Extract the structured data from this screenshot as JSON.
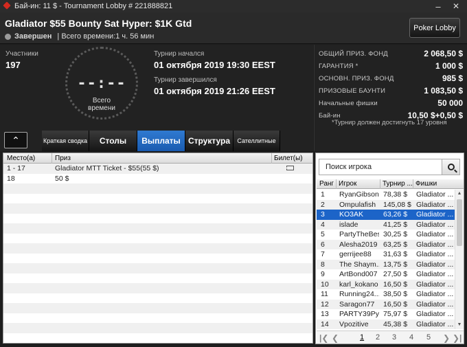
{
  "window": {
    "title": "Бай-ин: 11 $ - Tournament Lobby # 221888821",
    "min": "–",
    "close": "✕"
  },
  "header": {
    "tournament_name": "Gladiator $55 Bounty Sat Hyper: $1K Gtd",
    "status": "Завершен",
    "total_time": "| Всего времени:1 ч. 56 мин",
    "lobby_button": "Poker Lobby"
  },
  "info": {
    "participants_label": "Участники",
    "participants": "197",
    "clock_digits": "--:--",
    "clock_caption": "Всего времени",
    "started_label": "Турнир начался",
    "started": "01 октября 2019  19:30 EEST",
    "finished_label": "Турнир завершился",
    "finished": "01 октября 2019  21:26 EEST"
  },
  "prize": {
    "rows": [
      {
        "k": "ОБЩИЙ ПРИЗ. ФОНД",
        "v": "2 068,50 $"
      },
      {
        "k": "ГАРАНТИЯ *",
        "v": "1 000 $"
      },
      {
        "k": "ОСНОВН. ПРИЗ. ФОНД",
        "v": "985 $"
      },
      {
        "k": "ПРИЗОВЫЕ БАУНТИ",
        "v": "1 083,50 $"
      },
      {
        "k": "Начальные фишки",
        "v": "50 000"
      },
      {
        "k": "Бай-ин",
        "v": "10,50 $+0,50 $"
      }
    ],
    "note": "*Турнир должен достигнуть 17 уровня"
  },
  "tabs": [
    "Краткая сводка",
    "Столы",
    "Выплаты",
    "Структура",
    "Сателлитные"
  ],
  "payouts": {
    "headers": [
      "Место(а)",
      "Приз",
      "Билет(ы)"
    ],
    "rows": [
      {
        "place": "1 - 17",
        "prize": "Gladiator MTT Ticket - $55(55 $)",
        "ticket": true
      },
      {
        "place": "18",
        "prize": "50 $",
        "ticket": false
      }
    ]
  },
  "players": {
    "search_placeholder": "Поиск игрока",
    "headers": [
      "Ранг",
      "Игрок",
      "Турнир ...",
      "Фишки"
    ],
    "rows": [
      {
        "rank": "1",
        "name": "RyanGibson",
        "won": "78,38 $",
        "chips": "Gladiator ..."
      },
      {
        "rank": "2",
        "name": "Ompulafish",
        "won": "145,08 $",
        "chips": "Gladiator ..."
      },
      {
        "rank": "3",
        "name": "KO3AK",
        "won": "63,26 $",
        "chips": "Gladiator ..."
      },
      {
        "rank": "4",
        "name": "islade",
        "won": "41,25 $",
        "chips": "Gladiator ..."
      },
      {
        "rank": "5",
        "name": "PartyTheBes",
        "won": "30,25 $",
        "chips": "Gladiator ..."
      },
      {
        "rank": "6",
        "name": "Alesha2019",
        "won": "63,25 $",
        "chips": "Gladiator ..."
      },
      {
        "rank": "7",
        "name": "gerrijee88",
        "won": "31,63 $",
        "chips": "Gladiator ..."
      },
      {
        "rank": "8",
        "name": "The Shaym...",
        "won": "13,75 $",
        "chips": "Gladiator ..."
      },
      {
        "rank": "9",
        "name": "ArtBond007",
        "won": "27,50 $",
        "chips": "Gladiator ..."
      },
      {
        "rank": "10",
        "name": "karl_kokano",
        "won": "16,50 $",
        "chips": "Gladiator ..."
      },
      {
        "rank": "11",
        "name": "Running24...",
        "won": "38,50 $",
        "chips": "Gladiator ..."
      },
      {
        "rank": "12",
        "name": "Saragon77",
        "won": "16,50 $",
        "chips": "Gladiator ..."
      },
      {
        "rank": "13",
        "name": "PARTY39PyC",
        "won": "75,97 $",
        "chips": "Gladiator ..."
      },
      {
        "rank": "14",
        "name": "Vpozitive",
        "won": "45,38 $",
        "chips": "Gladiator ..."
      }
    ],
    "selected_index": 2,
    "pager": [
      "1",
      "2",
      "3",
      "4",
      "5"
    ],
    "current_page": "1"
  }
}
